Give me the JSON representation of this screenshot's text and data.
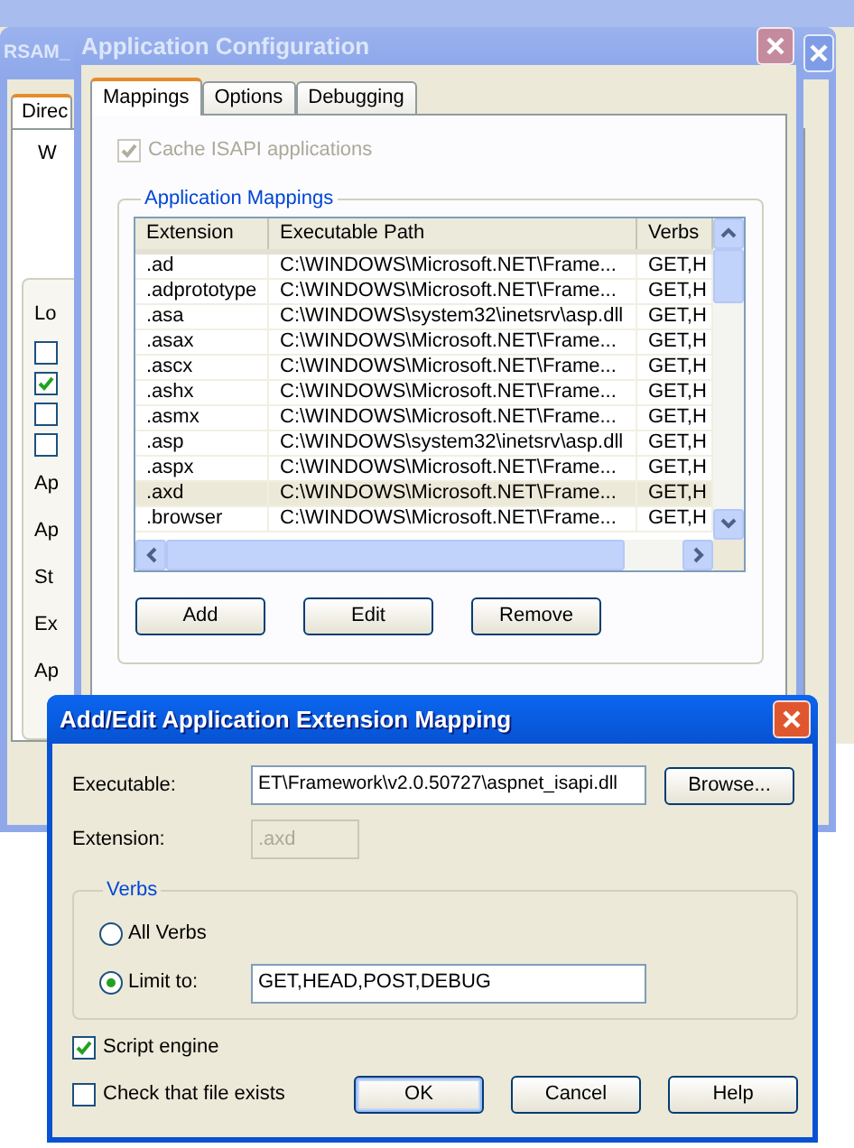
{
  "background_window": {
    "title": "RSAM_",
    "active": false,
    "tabs": [
      {
        "label": "Direc",
        "selected": true
      }
    ],
    "panel_text": "W",
    "group_items": [
      {
        "kind": "label",
        "text": "Lo"
      },
      {
        "kind": "checkbox",
        "checked": false
      },
      {
        "kind": "checkbox",
        "checked": true
      },
      {
        "kind": "checkbox",
        "checked": false
      },
      {
        "kind": "checkbox",
        "checked": false
      },
      {
        "kind": "label",
        "text": "Ap"
      },
      {
        "kind": "label",
        "text": "Ap"
      },
      {
        "kind": "label",
        "text": "St"
      },
      {
        "kind": "label",
        "text": "Ex"
      },
      {
        "kind": "label",
        "text": "Ap"
      }
    ]
  },
  "config_window": {
    "title": "Application Configuration",
    "active": false,
    "tabs": [
      {
        "label": "Mappings",
        "selected": true
      },
      {
        "label": "Options",
        "selected": false
      },
      {
        "label": "Debugging",
        "selected": false
      }
    ],
    "cache_isapi": {
      "label": "Cache ISAPI applications",
      "checked": true,
      "disabled": true
    },
    "group_title": "Application Mappings",
    "table": {
      "columns": [
        "Extension",
        "Executable Path",
        "Verbs"
      ],
      "rows": [
        {
          "cells": [
            ".ad",
            "C:\\WINDOWS\\Microsoft.NET\\Frame...",
            "GET,H"
          ],
          "selected": false
        },
        {
          "cells": [
            ".adprototype",
            "C:\\WINDOWS\\Microsoft.NET\\Frame...",
            "GET,H"
          ],
          "selected": false
        },
        {
          "cells": [
            ".asa",
            "C:\\WINDOWS\\system32\\inetsrv\\asp.dll",
            "GET,H"
          ],
          "selected": false
        },
        {
          "cells": [
            ".asax",
            "C:\\WINDOWS\\Microsoft.NET\\Frame...",
            "GET,H"
          ],
          "selected": false
        },
        {
          "cells": [
            ".ascx",
            "C:\\WINDOWS\\Microsoft.NET\\Frame...",
            "GET,H"
          ],
          "selected": false
        },
        {
          "cells": [
            ".ashx",
            "C:\\WINDOWS\\Microsoft.NET\\Frame...",
            "GET,H"
          ],
          "selected": false
        },
        {
          "cells": [
            ".asmx",
            "C:\\WINDOWS\\Microsoft.NET\\Frame...",
            "GET,H"
          ],
          "selected": false
        },
        {
          "cells": [
            ".asp",
            "C:\\WINDOWS\\system32\\inetsrv\\asp.dll",
            "GET,H"
          ],
          "selected": false
        },
        {
          "cells": [
            ".aspx",
            "C:\\WINDOWS\\Microsoft.NET\\Frame...",
            "GET,H"
          ],
          "selected": false
        },
        {
          "cells": [
            ".axd",
            "C:\\WINDOWS\\Microsoft.NET\\Frame...",
            "GET,H"
          ],
          "selected": true
        },
        {
          "cells": [
            ".browser",
            "C:\\WINDOWS\\Microsoft.NET\\Frame...",
            "GET,H"
          ],
          "selected": false
        }
      ]
    },
    "buttons": [
      "Add",
      "Edit",
      "Remove"
    ]
  },
  "dialog": {
    "title": "Add/Edit Application Extension Mapping",
    "active": true,
    "executable": {
      "label": "Executable:",
      "value": "ET\\Framework\\v2.0.50727\\aspnet_isapi.dll"
    },
    "browse_button": "Browse...",
    "extension": {
      "label": "Extension:",
      "value": ".axd",
      "disabled": true
    },
    "verbs": {
      "title": "Verbs",
      "options": [
        {
          "label": "All Verbs",
          "selected": false
        },
        {
          "label": "Limit to:",
          "selected": true,
          "value": "GET,HEAD,POST,DEBUG"
        }
      ]
    },
    "checkboxes": [
      {
        "label": "Script engine",
        "checked": true
      },
      {
        "label": "Check that file exists",
        "checked": false
      }
    ],
    "buttons": [
      {
        "label": "OK",
        "default": true
      },
      {
        "label": "Cancel",
        "default": false
      },
      {
        "label": "Help",
        "default": false
      }
    ]
  }
}
